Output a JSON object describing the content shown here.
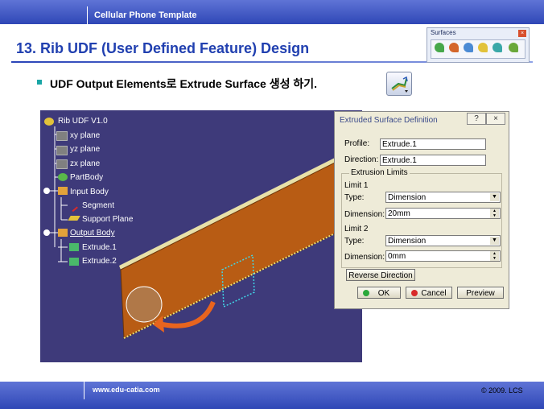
{
  "header": {
    "template_title": "Cellular Phone Template"
  },
  "slide": {
    "title": "13. Rib UDF (User Defined Feature) Design",
    "bullet": "UDF Output Elements로 Extrude Surface 생성 하기."
  },
  "toolbar": {
    "title": "Surfaces",
    "close": "×"
  },
  "tree": {
    "root": "Rib UDF V1.0",
    "xy_plane": "xy plane",
    "yz_plane": "yz plane",
    "zx_plane": "zx plane",
    "partbody": "PartBody",
    "input_body": "Input Body",
    "segment": "Segment",
    "support_plane": "Support Plane",
    "output_body": "Output Body",
    "extrude1": "Extrude.1",
    "extrude2": "Extrude.2"
  },
  "dialog": {
    "title": "Extruded Surface Definition",
    "help_btn": "?",
    "close_btn": "×",
    "profile_label": "Profile:",
    "profile_value": "Extrude.1",
    "direction_label": "Direction:",
    "direction_value": "Extrude.1",
    "limits_group": "Extrusion Limits",
    "limit1_label": "Limit 1",
    "limit1_type_label": "Type:",
    "limit1_type_value": "Dimension",
    "limit1_dim_label": "Dimension:",
    "limit1_dim_value": "20mm",
    "limit2_label": "Limit 2",
    "limit2_type_label": "Type:",
    "limit2_type_value": "Dimension",
    "limit2_dim_label": "Dimension:",
    "limit2_dim_value": "0mm",
    "reverse_btn": "Reverse Direction",
    "ok_btn": "OK",
    "cancel_btn": "Cancel",
    "preview_btn": "Preview"
  },
  "footer": {
    "website": "www.edu-catia.com",
    "copyright": "© 2009. LCS"
  },
  "colors": {
    "band": "#3a52c0",
    "title": "#2140b0",
    "viewport": "#3e3a7a",
    "rib_surface": "#b85c14",
    "dialog_bg": "#eeebd8",
    "arrow": "#e8641e"
  }
}
